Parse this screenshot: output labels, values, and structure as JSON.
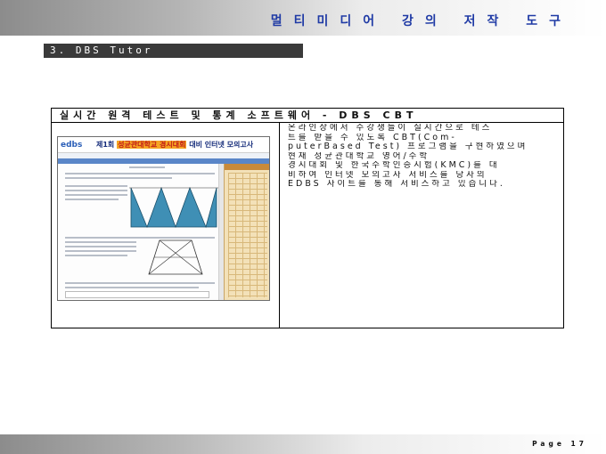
{
  "header": {
    "title": "멀티미디어 강의 저작 도구"
  },
  "section": {
    "label": "3. DBS Tutor"
  },
  "panel": {
    "heading": "실시간 원격 테스트 및 통계 소프트웨어 - DBS CBT",
    "description": [
      "온라인상에서 수강생들이 실시간으로 테스",
      "트를 받을 수 있도록 CBT(Com-",
      "puterBased Test) 프로그램을 구현하였으며",
      "현재 성균관대학교 영어/수학",
      "경시대회 및 한국수학인증시험(KMC)를 대",
      "비하여 인터넷 모의고사 서비스를 당사의",
      "EDBS 사이트를 통해 서비스하고 있습니다."
    ]
  },
  "screenshot": {
    "logo": "edbs",
    "exam_title_prefix": "제1회",
    "exam_title_highlight": "성균관대학교 경시대회",
    "exam_title_suffix": "대비 인터넷 모의고사"
  },
  "footer": {
    "page_label": "Page 17"
  }
}
